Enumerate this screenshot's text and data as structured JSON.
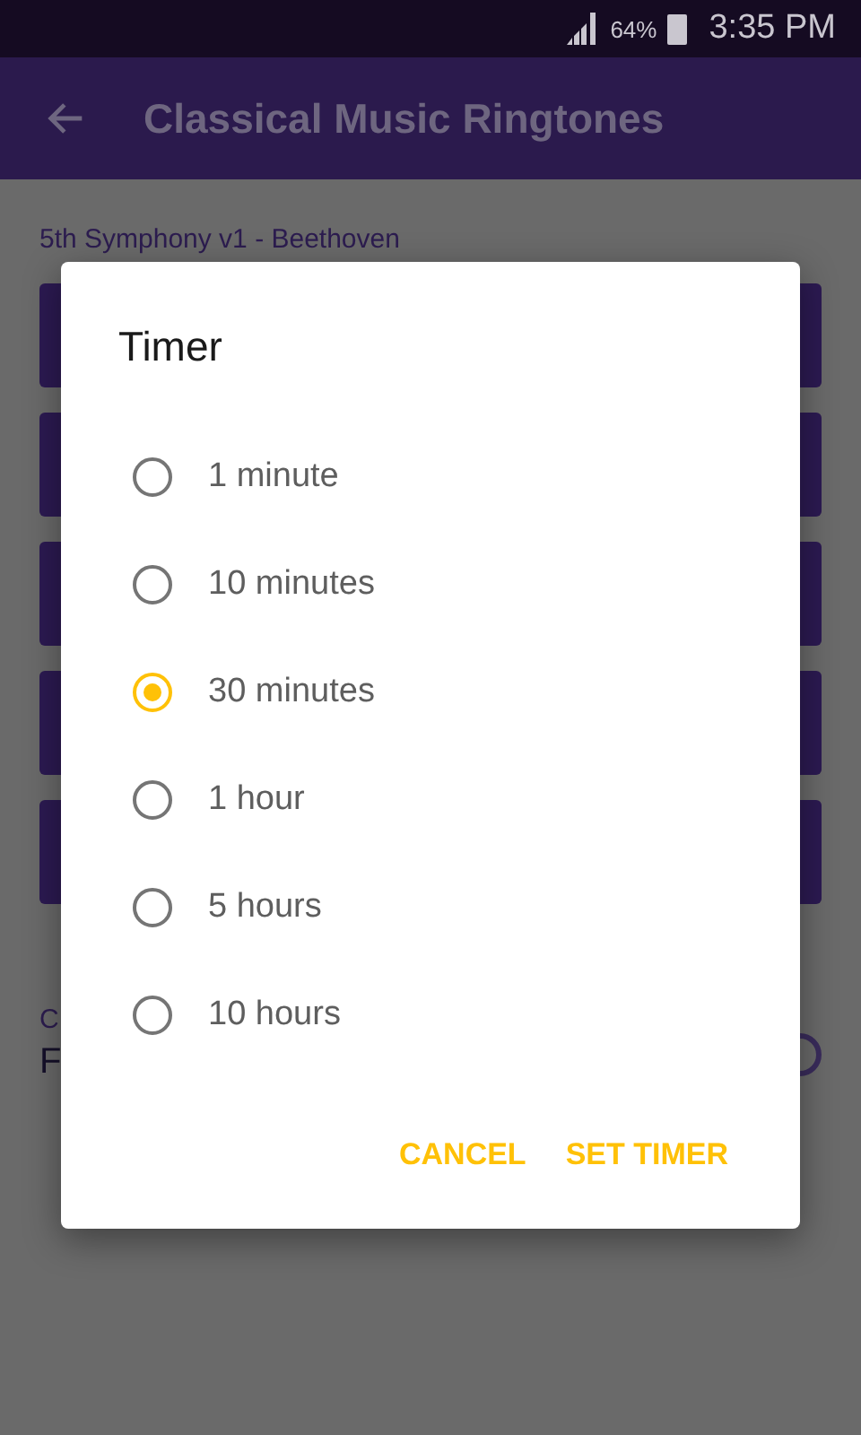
{
  "status_bar": {
    "battery": "64%",
    "time": "3:35 PM"
  },
  "app_bar": {
    "title": "Classical Music Ringtones"
  },
  "background": {
    "song": "5th Symphony v1 - Beethoven",
    "bars": [
      {
        "kind": "bar"
      },
      {
        "kind": "bar"
      },
      {
        "kind": "bar"
      },
      {
        "kind": "bar"
      },
      {
        "kind": "bar"
      }
    ],
    "caption": "C",
    "value": "F"
  },
  "dialog": {
    "title": "Timer",
    "options": [
      {
        "label": "1 minute",
        "selected": false
      },
      {
        "label": "10 minutes",
        "selected": false
      },
      {
        "label": "30 minutes",
        "selected": true
      },
      {
        "label": "1 hour",
        "selected": false
      },
      {
        "label": "5 hours",
        "selected": false
      },
      {
        "label": "10 hours",
        "selected": false
      }
    ],
    "actions": [
      "CANCEL",
      "SET TIMER"
    ]
  }
}
